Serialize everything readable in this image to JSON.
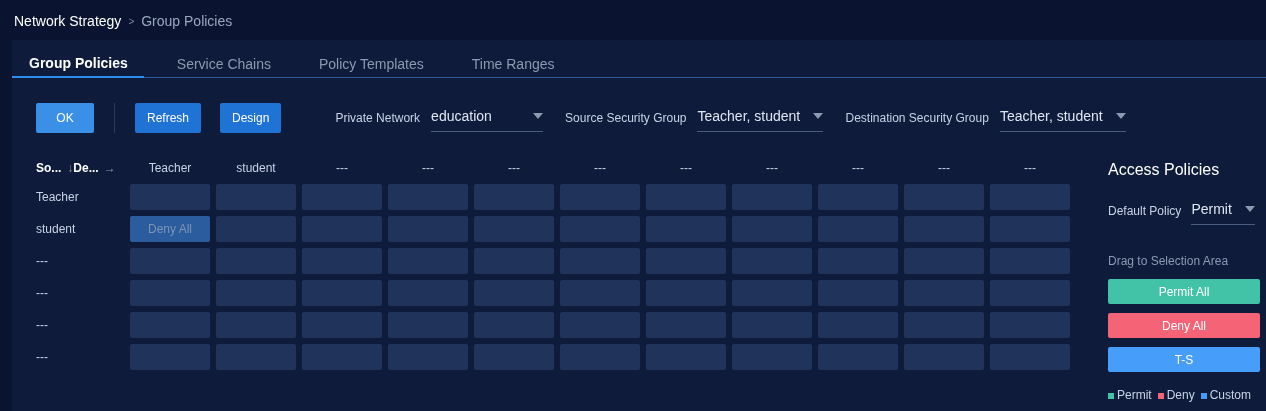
{
  "breadcrumb": [
    {
      "label": "Network Strategy",
      "current": false
    },
    {
      "separator": ">",
      "label": "Group Policies",
      "current": true
    }
  ],
  "tabs": [
    {
      "label": "Group Policies",
      "selected": true
    },
    {
      "label": "Service Chains",
      "selected": false
    },
    {
      "label": "Policy Templates",
      "selected": false
    },
    {
      "label": "Time Ranges",
      "selected": false
    }
  ],
  "toolbar": {
    "buttons": [
      {
        "label": "OK",
        "kind": "primary"
      },
      {
        "label": "Refresh",
        "kind": "secondary"
      },
      {
        "label": "Design",
        "kind": "secondary"
      }
    ],
    "filters": [
      {
        "label": "Private Network",
        "value": "education"
      },
      {
        "label": "Source Security Group",
        "value": "Teacher, student"
      },
      {
        "label": "Destination Security Group",
        "value": "Teacher, student"
      }
    ]
  },
  "matrix": {
    "corner": {
      "source": "So...",
      "down_arrow": "↓",
      "destination": "De...",
      "right_arrow": "→"
    },
    "columns": [
      "Teacher",
      "student",
      "---",
      "---",
      "---",
      "---",
      "---",
      "---",
      "---",
      "---",
      "---"
    ],
    "rows": [
      {
        "label": "Teacher",
        "cells": [
          {
            "kind": "empty"
          },
          {
            "kind": "empty"
          },
          {
            "kind": "empty"
          },
          {
            "kind": "empty"
          },
          {
            "kind": "empty"
          },
          {
            "kind": "empty"
          },
          {
            "kind": "empty"
          },
          {
            "kind": "empty"
          },
          {
            "kind": "empty"
          },
          {
            "kind": "empty"
          },
          {
            "kind": "empty"
          }
        ]
      },
      {
        "label": "student",
        "cells": [
          {
            "kind": "policy",
            "label": "Deny All"
          },
          {
            "kind": "empty"
          },
          {
            "kind": "empty"
          },
          {
            "kind": "empty"
          },
          {
            "kind": "empty"
          },
          {
            "kind": "empty"
          },
          {
            "kind": "empty"
          },
          {
            "kind": "empty"
          },
          {
            "kind": "empty"
          },
          {
            "kind": "empty"
          },
          {
            "kind": "empty"
          }
        ]
      },
      {
        "label": "---",
        "cells": [
          {
            "kind": "empty"
          },
          {
            "kind": "empty"
          },
          {
            "kind": "empty"
          },
          {
            "kind": "empty"
          },
          {
            "kind": "empty"
          },
          {
            "kind": "empty"
          },
          {
            "kind": "empty"
          },
          {
            "kind": "empty"
          },
          {
            "kind": "empty"
          },
          {
            "kind": "empty"
          },
          {
            "kind": "empty"
          }
        ]
      },
      {
        "label": "---",
        "cells": [
          {
            "kind": "empty"
          },
          {
            "kind": "empty"
          },
          {
            "kind": "empty"
          },
          {
            "kind": "empty"
          },
          {
            "kind": "empty"
          },
          {
            "kind": "empty"
          },
          {
            "kind": "empty"
          },
          {
            "kind": "empty"
          },
          {
            "kind": "empty"
          },
          {
            "kind": "empty"
          },
          {
            "kind": "empty"
          }
        ]
      },
      {
        "label": "---",
        "cells": [
          {
            "kind": "empty"
          },
          {
            "kind": "empty"
          },
          {
            "kind": "empty"
          },
          {
            "kind": "empty"
          },
          {
            "kind": "empty"
          },
          {
            "kind": "empty"
          },
          {
            "kind": "empty"
          },
          {
            "kind": "empty"
          },
          {
            "kind": "empty"
          },
          {
            "kind": "empty"
          },
          {
            "kind": "empty"
          }
        ]
      },
      {
        "label": "---",
        "cells": [
          {
            "kind": "empty"
          },
          {
            "kind": "empty"
          },
          {
            "kind": "empty"
          },
          {
            "kind": "empty"
          },
          {
            "kind": "empty"
          },
          {
            "kind": "empty"
          },
          {
            "kind": "empty"
          },
          {
            "kind": "empty"
          },
          {
            "kind": "empty"
          },
          {
            "kind": "empty"
          },
          {
            "kind": "empty"
          }
        ]
      }
    ]
  },
  "access_policies": {
    "title": "Access Policies",
    "default_policy": {
      "label": "Default Policy",
      "value": "Permit"
    },
    "hint": "Drag to Selection Area",
    "policies": [
      {
        "label": "Permit All",
        "color": "#42c2a6"
      },
      {
        "label": "Deny All",
        "color": "#f56376"
      },
      {
        "label": "T-S",
        "color": "#479dfa"
      }
    ],
    "legend": [
      {
        "label": "Permit",
        "color": "#42c2a6"
      },
      {
        "label": "Deny",
        "color": "#f56376"
      },
      {
        "label": "Custom",
        "color": "#479dfa"
      }
    ]
  }
}
